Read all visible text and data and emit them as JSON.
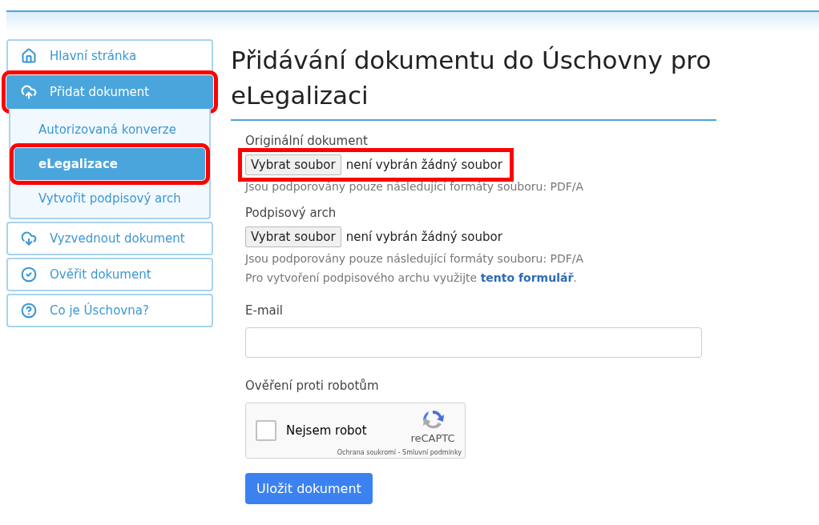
{
  "nav": [
    {
      "label": "Hlavní stránka",
      "kind": "home",
      "selected": false,
      "highlighted": false
    },
    {
      "label": "Přidat dokument",
      "kind": "upload",
      "selected": true,
      "highlighted": true,
      "children": [
        {
          "label": "Autorizovaná konverze",
          "selected": false,
          "highlighted": false
        },
        {
          "label": "eLegalizace",
          "selected": true,
          "highlighted": true
        },
        {
          "label": "Vytvořit podpisový arch",
          "selected": false,
          "highlighted": false
        }
      ]
    },
    {
      "label": "Vyzvednout dokument",
      "kind": "download",
      "selected": false,
      "highlighted": false
    },
    {
      "label": "Ověřit dokument",
      "kind": "check",
      "selected": false,
      "highlighted": false
    },
    {
      "label": "Co je Úschovna?",
      "kind": "help",
      "selected": false,
      "highlighted": false
    }
  ],
  "heading": "Přidávání dokumentu do Úschovny pro eLegalizaci",
  "files": [
    {
      "label": "Originální dokument",
      "button": "Vybrat soubor",
      "status": "není vybrán žádný soubor",
      "hint": "Jsou podporovány pouze následující formáty souboru: PDF/A",
      "highlighted": true
    },
    {
      "label": "Podpisový arch",
      "button": "Vybrat soubor",
      "status": "není vybrán žádný soubor",
      "hint": "Jsou podporovány pouze následující formáty souboru: PDF/A",
      "highlighted": false,
      "note": {
        "text": "Pro vytvoření podpisového archu využijte",
        "link": "tento formulář",
        "after": "."
      }
    }
  ],
  "email": {
    "label": "E-mail"
  },
  "captcha": {
    "label": "Ověření proti robotům",
    "checkbox": "Nejsem robot",
    "checked": false,
    "brand": "reCAPTC",
    "footer": "Ochrana soukromí - Smluvní podmínky"
  },
  "submit": "Uložit dokument"
}
